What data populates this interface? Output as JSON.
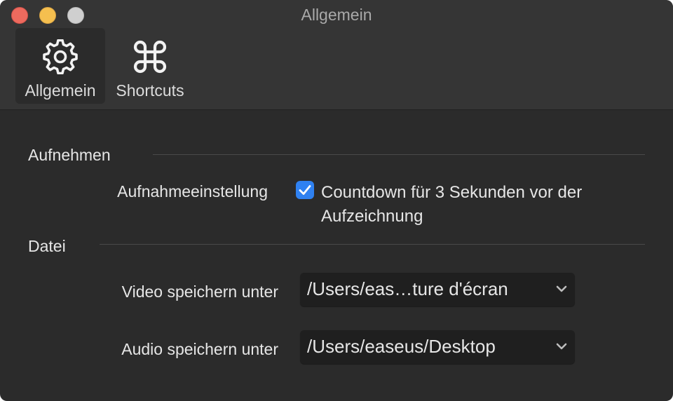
{
  "window": {
    "title": "Allgemein"
  },
  "toolbar": {
    "tabs": [
      {
        "label": "Allgemein",
        "icon": "gear-icon",
        "active": true
      },
      {
        "label": "Shortcuts",
        "icon": "command-icon",
        "active": false
      }
    ]
  },
  "sections": {
    "recording": {
      "title": "Aufnehmen",
      "setting_label": "Aufnahmeeinstellung",
      "countdown_checkbox": {
        "checked": true,
        "label": "Countdown für 3 Sekunden vor der Aufzeichnung"
      }
    },
    "file": {
      "title": "Datei",
      "video_label": "Video speichern unter",
      "video_path": "/Users/eas…ture d'écran",
      "audio_label": "Audio speichern unter",
      "audio_path": "/Users/easeus/Desktop"
    }
  },
  "colors": {
    "accent": "#2f81f1",
    "close": "#ed6a5e",
    "minimize": "#f5bf4f",
    "maximize": "#cfcfcf",
    "background": "#2b2b2b",
    "toolbar": "#353535"
  }
}
